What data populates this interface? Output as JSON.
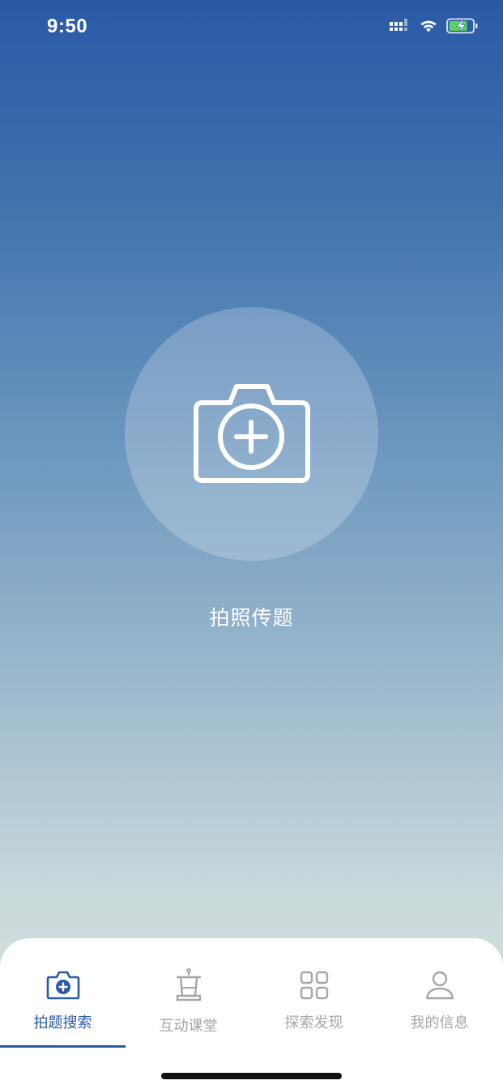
{
  "status_bar": {
    "time": "9:50"
  },
  "main": {
    "camera_label": "拍照传题"
  },
  "tabs": [
    {
      "label": "拍题搜索",
      "icon": "camera-plus-icon",
      "active": true
    },
    {
      "label": "互动课堂",
      "icon": "podium-icon",
      "active": false
    },
    {
      "label": "探索发现",
      "icon": "grid-icon",
      "active": false
    },
    {
      "label": "我的信息",
      "icon": "user-icon",
      "active": false
    }
  ],
  "colors": {
    "accent": "#2a5aa6",
    "inactive": "#a6a6a6",
    "battery": "#5ad15a"
  }
}
